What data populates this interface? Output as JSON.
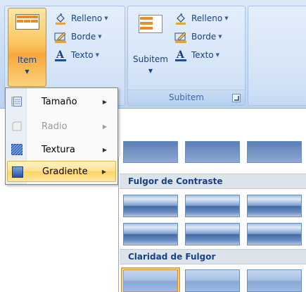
{
  "colors": {
    "ribbon_bg": "#c7dcf4",
    "ribbon_text": "#15428b",
    "active_button": "#fbc561",
    "menu_highlight": "#ffe08f",
    "gallery_header": "#dde3eb"
  },
  "ribbon": {
    "group_item": {
      "big_button": {
        "label": "Item",
        "icon": "shape-style-icon"
      },
      "small_buttons": [
        {
          "label": "Relleno",
          "icon": "paint-bucket-icon"
        },
        {
          "label": "Borde",
          "icon": "pencil-border-icon"
        },
        {
          "label": "Texto",
          "icon": "text-color-icon"
        }
      ]
    },
    "group_subitem": {
      "big_button": {
        "label": "Subitem",
        "icon": "subitem-style-icon"
      },
      "small_buttons": [
        {
          "label": "Relleno",
          "icon": "paint-bucket-icon"
        },
        {
          "label": "Borde",
          "icon": "pencil-border-icon"
        },
        {
          "label": "Texto",
          "icon": "text-color-icon"
        }
      ],
      "footer_label": "Subitem"
    }
  },
  "menu": {
    "items": [
      {
        "label": "Tamaño",
        "icon": "size-icon",
        "enabled": true,
        "highlighted": false
      },
      {
        "label": "Radio",
        "icon": "radius-icon",
        "enabled": false,
        "highlighted": false
      },
      {
        "label": "Textura",
        "icon": "texture-icon",
        "enabled": true,
        "highlighted": false
      },
      {
        "label": "Gradiente",
        "icon": "gradient-icon",
        "enabled": true,
        "highlighted": true
      }
    ]
  },
  "gallery": {
    "categories": [
      {
        "title": "Fulgor de Contraste"
      },
      {
        "title": "Claridad de Fulgor"
      }
    ]
  }
}
